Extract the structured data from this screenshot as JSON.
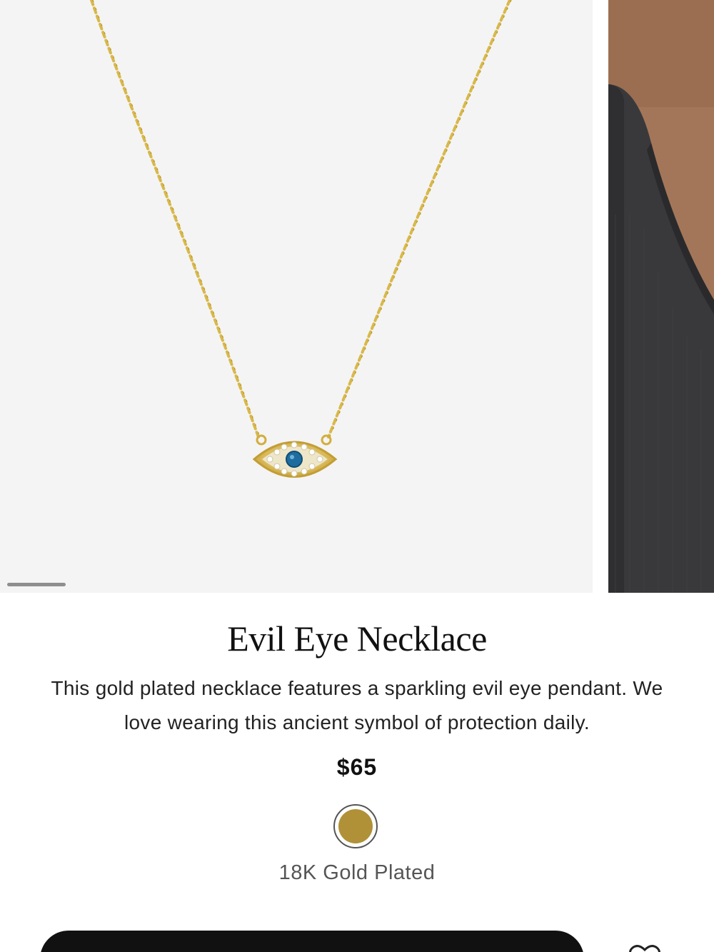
{
  "product": {
    "title": "Evil Eye Necklace",
    "description": "This gold plated necklace features a sparkling evil eye pendant. We love wearing this ancient symbol of protection daily.",
    "price": "$65",
    "images": {
      "main": "necklace-product-photo",
      "next": "necklace-model-photo"
    }
  },
  "gallery": {
    "current_slide": 1
  },
  "variant": {
    "label": "18K Gold Plated",
    "color": "#b09138"
  },
  "colors": {
    "gold_chain": "#d9b94a",
    "eye_stone": "#1f6d9e",
    "button": "#111111",
    "image_bg": "#f4f4f4"
  },
  "icons": {
    "wishlist": "heart-icon"
  }
}
